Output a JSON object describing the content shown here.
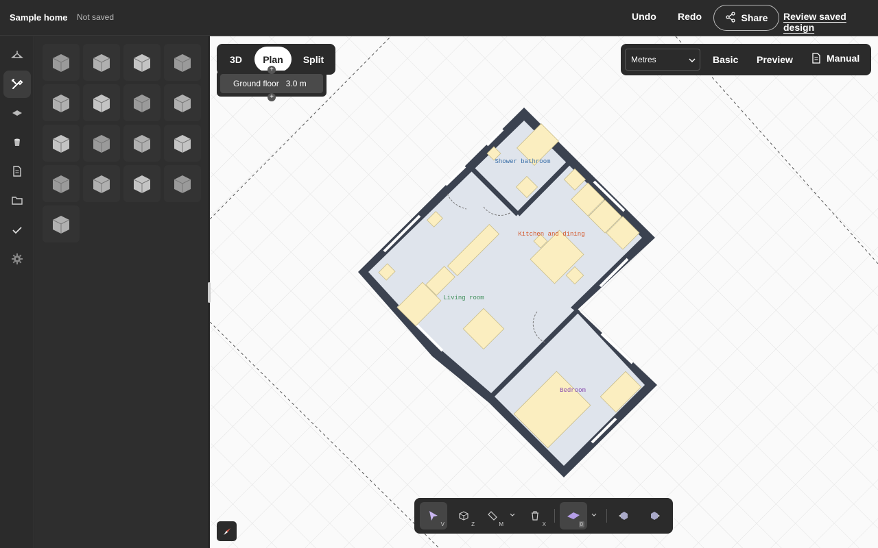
{
  "header": {
    "project_name": "Sample home",
    "save_status": "Not saved",
    "undo": "Undo",
    "redo": "Redo",
    "share": "Share",
    "review": "Review saved design"
  },
  "rail": {
    "items": [
      {
        "icon": "floorplan-icon"
      },
      {
        "icon": "tools-icon",
        "active": true
      },
      {
        "icon": "surface-icon"
      },
      {
        "icon": "paint-icon"
      },
      {
        "icon": "document-icon"
      },
      {
        "icon": "folder-icon"
      },
      {
        "icon": "checkmark-icon"
      },
      {
        "icon": "settings-gear-icon"
      }
    ]
  },
  "catalog": {
    "items": [
      "wall-icon",
      "fence-icon",
      "slab-icon",
      "ladder-icon",
      "grid-floor-icon",
      "door-icon",
      "window-icon",
      "column-icon",
      "box-icon",
      "fridge-icon",
      "fountain-icon",
      "roof-icon",
      "stairs-icon",
      "room-icon",
      "cabinet-icon",
      "bucket-icon",
      "terrain-icon"
    ]
  },
  "view": {
    "options": [
      "3D",
      "Plan",
      "Split"
    ],
    "active": "Plan",
    "floor_name": "Ground floor",
    "floor_height": "3.0 m"
  },
  "right_panel": {
    "units": "Metres",
    "basic": "Basic",
    "preview": "Preview",
    "manual": "Manual"
  },
  "plan": {
    "rooms": [
      {
        "name": "Shower bathroom",
        "color": "#3a6fa8"
      },
      {
        "name": "Kitchen and dining",
        "color": "#d4572a"
      },
      {
        "name": "Living room",
        "color": "#3f8f5a"
      },
      {
        "name": "Bedroom",
        "color": "#8a4fb0"
      }
    ],
    "wall_color": "#3b4250",
    "floor_color": "#dfe4ec",
    "furniture_color": "#fbeec0"
  },
  "toolbar": {
    "tools": [
      {
        "icon": "select-cursor-icon",
        "key": "V",
        "active": true
      },
      {
        "icon": "zone-icon",
        "key": "Z"
      },
      {
        "icon": "measure-icon",
        "key": "M"
      },
      {
        "icon": "delete-icon",
        "key": "X"
      },
      {
        "icon": "layer-icon",
        "key": "0",
        "active": true
      },
      {
        "icon": "camera-left-icon"
      },
      {
        "icon": "camera-right-icon"
      }
    ]
  }
}
